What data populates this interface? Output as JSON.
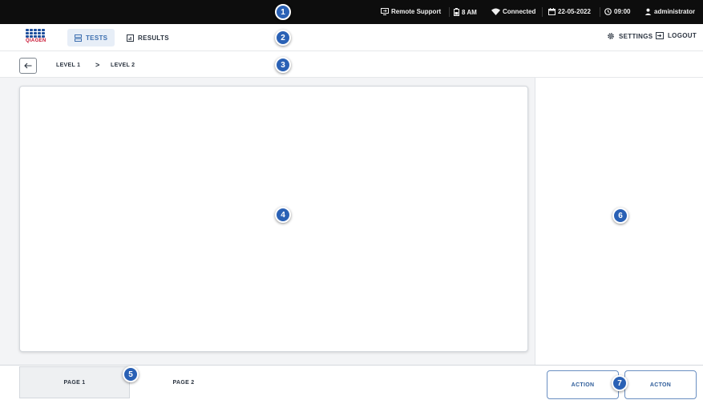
{
  "status_bar": {
    "remote_support": "Remote Support",
    "battery": "8 AM",
    "network": "Connected",
    "date": "22-05-2022",
    "time": "09:00",
    "user": "administrator"
  },
  "nav": {
    "logo_text": "QIAGEN",
    "tabs": [
      {
        "label": "TESTS",
        "icon": "tests-icon",
        "active": true
      },
      {
        "label": "RESULTS",
        "icon": "results-icon",
        "active": false
      }
    ],
    "settings_label": "SETTINGS",
    "logout_label": "LOGOUT"
  },
  "breadcrumb": {
    "levels": [
      "LEVEL 1",
      "LEVEL 2"
    ],
    "separator": ">"
  },
  "footer": {
    "pages": [
      {
        "label": "PAGE 1",
        "active": true
      },
      {
        "label": "PAGE 2",
        "active": false
      }
    ],
    "actions": [
      "ACTION",
      "ACTON"
    ]
  },
  "markers": [
    "1",
    "2",
    "3",
    "4",
    "5",
    "6",
    "7"
  ],
  "colors": {
    "status_bar_bg": "#0d0d0d",
    "accent": "#3d6fb0",
    "marker": "#2a61b5",
    "logo_red": "#c8102e"
  }
}
